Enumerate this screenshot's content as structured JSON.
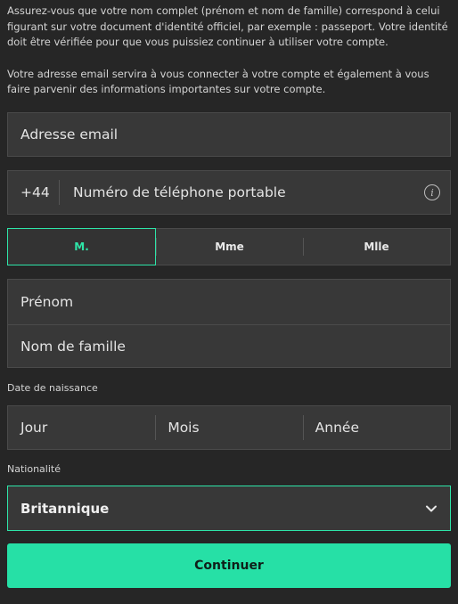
{
  "intro": {
    "paragraph1": "Assurez-vous que votre nom complet (prénom et nom de famille) correspond à celui figurant sur votre document d'identité officiel, par exemple : passeport. Votre identité doit être vérifiée pour que vous puissiez continuer à utiliser votre compte.",
    "paragraph2": "Votre adresse email servira à vous connecter à votre compte et également à vous faire parvenir des informations importantes sur votre compte."
  },
  "email": {
    "placeholder": "Adresse email"
  },
  "phone": {
    "prefix": "+44",
    "placeholder": "Numéro de téléphone portable",
    "info_glyph": "i",
    "icon": "info-icon"
  },
  "title_options": [
    {
      "label": "M.",
      "selected": true
    },
    {
      "label": "Mme",
      "selected": false
    },
    {
      "label": "Mlle",
      "selected": false
    }
  ],
  "names": {
    "first_name_placeholder": "Prénom",
    "last_name_placeholder": "Nom de famille"
  },
  "dob": {
    "label": "Date de naissance",
    "day": "Jour",
    "month": "Mois",
    "year": "Année"
  },
  "nationality": {
    "label": "Nationalité",
    "value": "Britannique",
    "icon": "chevron-down-icon"
  },
  "continue_button": {
    "label": "Continuer"
  },
  "colors": {
    "accent": "#26e0a6",
    "background": "#262626",
    "field": "#383838"
  }
}
